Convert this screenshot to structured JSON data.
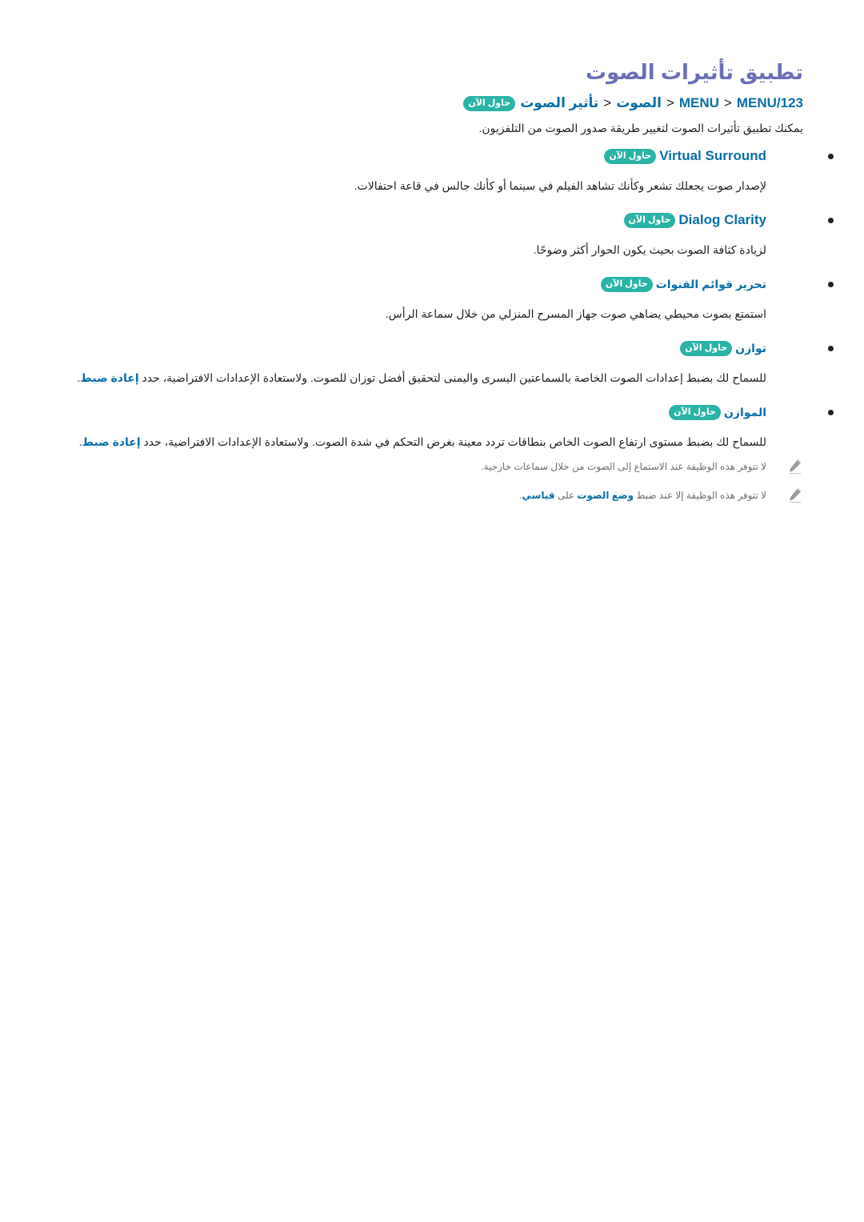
{
  "title": "تطبيق تأثيرات الصوت",
  "path": {
    "items": [
      "MENU/123",
      "MENU",
      "الصوت",
      "تأثير الصوت"
    ],
    "separator": "<",
    "badge": "حاول الآن"
  },
  "intro": "يمكنك تطبيق تأثيرات الصوت لتغيير طريقة صدور الصوت من التلفزيون.",
  "badge_label": "حاول الآن",
  "items": [
    {
      "name": "Virtual Surround",
      "latin": true,
      "desc": "لإصدار صوت يجعلك تشعر وكأنك تشاهد الفيلم في سينما أو كأنك جالس في قاعة احتفالات."
    },
    {
      "name": "Dialog Clarity",
      "latin": true,
      "desc": "لزيادة كثافة الصوت بحيث يكون الحوار أكثر وضوحًا."
    },
    {
      "name": "تحرير قوائم القنوات",
      "latin": false,
      "desc": "استمتع بصوت محيطي يضاهي صوت جهاز المسرح المنزلي من خلال سماعة الرأس."
    },
    {
      "name": "توازن",
      "latin": false,
      "desc": "للسماح لك بضبط إعدادات الصوت الخاصة بالسماعتين اليسرى واليمنى لتحقيق أفضل توزان للصوت. ولاستعادة الإعدادات الافتراضية، حدد",
      "desc_link": "إعادة ضبط",
      "desc_end": "."
    },
    {
      "name": "الموازن",
      "latin": false,
      "desc": "للسماح لك بضبط مستوى ارتفاع الصوت الخاص بنطاقات تردد معينة بغرض التحكم في شدة الصوت. ولاستعادة الإعدادات الافتراضية، حدد",
      "desc_link": "إعادة ضبط",
      "desc_end": "."
    }
  ],
  "notes": [
    {
      "icon": "pencil-icon",
      "text": "لا تتوفر هذه الوظيفة عند الاستماع إلى الصوت من خلال سماعات خارجية."
    },
    {
      "icon": "pencil-icon",
      "text_before": "لا تتوفر هذه الوظيفة إلا عند ضبط",
      "link1": "وضع الصوت",
      "text_mid": "على",
      "link2": "قياسي",
      "text_end": "."
    }
  ],
  "colors": {
    "title": "#6a6fb8",
    "link": "#0b6fa8",
    "badge": "#2bb3a6",
    "text": "#231f20",
    "note": "#6d6e71"
  }
}
